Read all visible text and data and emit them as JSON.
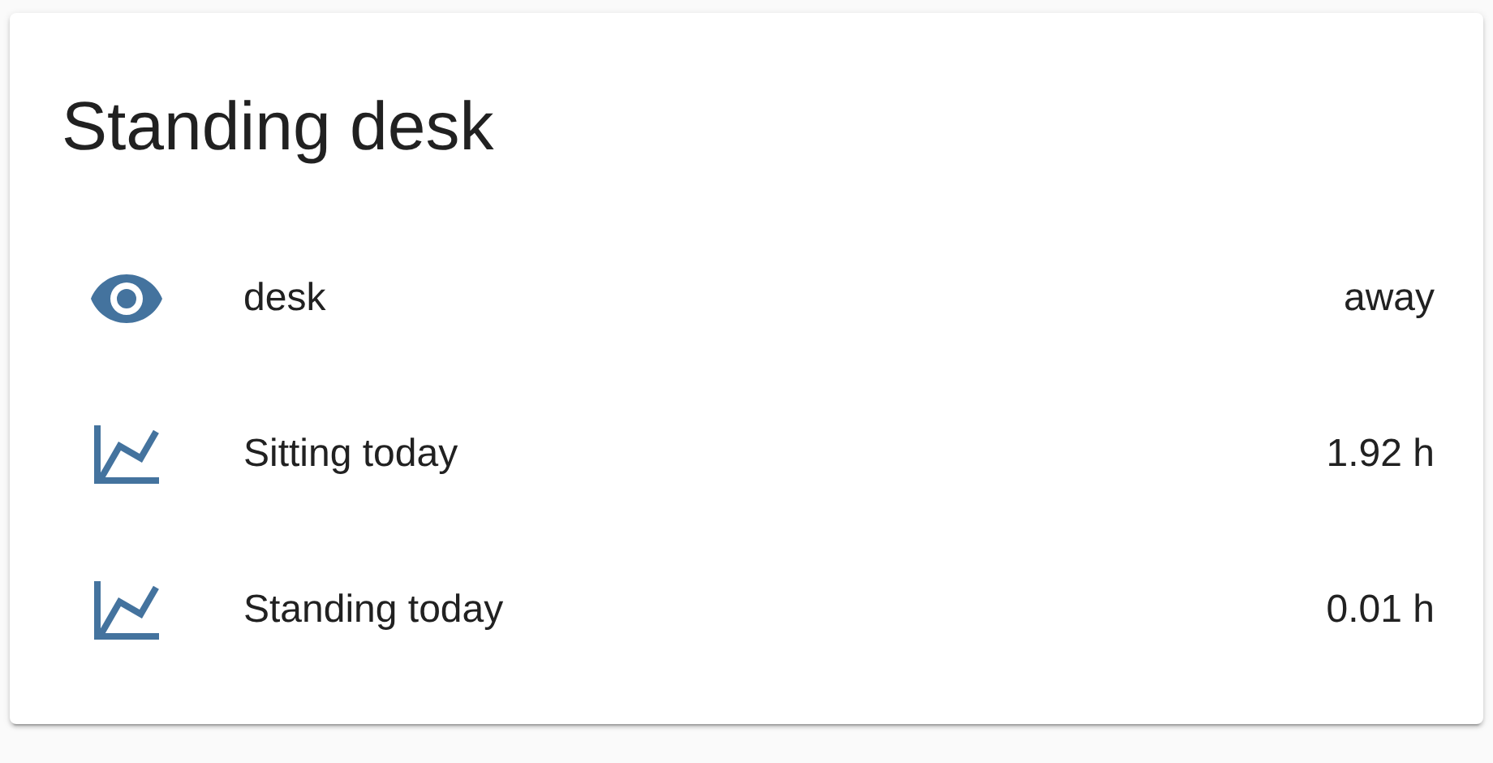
{
  "card": {
    "title": "Standing desk",
    "rows": [
      {
        "kind": "presence",
        "name": "desk",
        "state": "away"
      },
      {
        "kind": "sensor",
        "name": "Sitting today",
        "state": "1.92 h"
      },
      {
        "kind": "sensor",
        "name": "Standing today",
        "state": "0.01 h"
      }
    ]
  }
}
